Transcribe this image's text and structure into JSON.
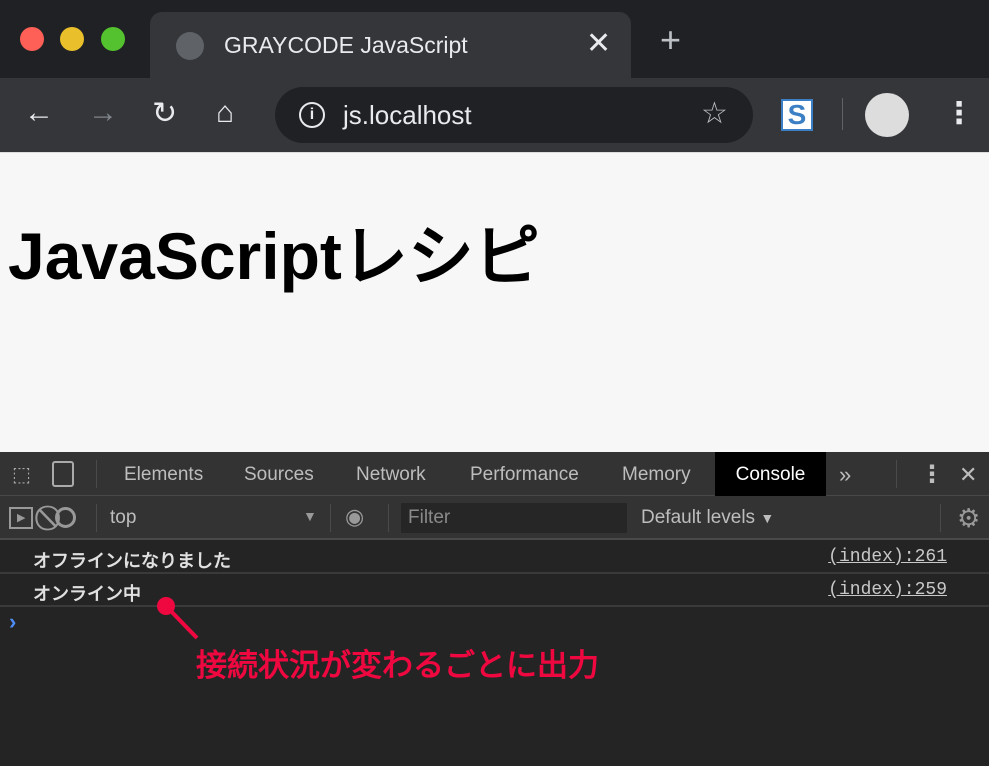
{
  "browser": {
    "tab_title": "GRAYCODE JavaScript",
    "url": "js.localhost"
  },
  "page": {
    "heading": "JavaScriptレシピ"
  },
  "devtools": {
    "tabs": [
      "Elements",
      "Sources",
      "Network",
      "Performance",
      "Memory",
      "Console"
    ],
    "active_tab": "Console",
    "context": "top",
    "filter_placeholder": "Filter",
    "levels": "Default levels",
    "logs": [
      {
        "message": "オフラインになりました",
        "source": "(index):261"
      },
      {
        "message": "オンライン中",
        "source": "(index):259"
      }
    ],
    "prompt": "›"
  },
  "annotation": {
    "text": "接続状況が変わるごとに出力",
    "color": "#ef0840"
  }
}
